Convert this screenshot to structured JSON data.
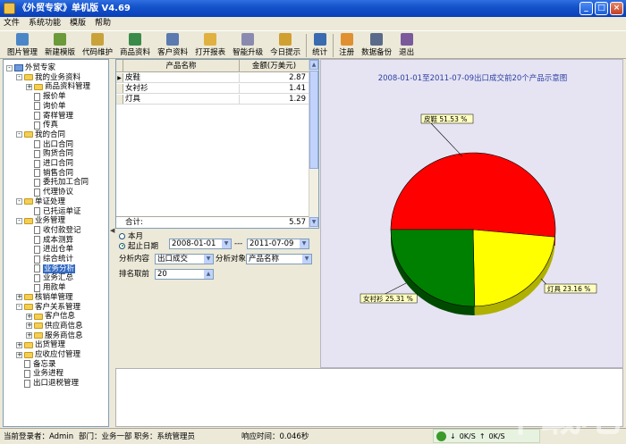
{
  "window": {
    "title": "《外贸专家》单机版 V4.69",
    "min": "_",
    "max": "□",
    "close": "×"
  },
  "menu": [
    "文件",
    "系统功能",
    "模版",
    "帮助"
  ],
  "toolbar": [
    {
      "label": "图片管理",
      "color": "#4a86c7"
    },
    {
      "label": "新建模版",
      "color": "#6a9a3a"
    },
    {
      "label": "代码维护",
      "color": "#c9a23a"
    },
    {
      "label": "商品资料",
      "color": "#3a8a4a"
    },
    {
      "label": "客户资料",
      "color": "#5a7ab0"
    },
    {
      "label": "打开报表",
      "color": "#e0b040"
    },
    {
      "label": "智能升级",
      "color": "#8a8ab0"
    },
    {
      "label": "今日提示",
      "color": "#d0a030"
    },
    {
      "label": "统计",
      "color": "#3a6ab0"
    },
    {
      "label": "注册",
      "color": "#e09030"
    },
    {
      "label": "数据备份",
      "color": "#5a6a8a"
    },
    {
      "label": "退出",
      "color": "#7a5a9a"
    }
  ],
  "tree": {
    "items": [
      {
        "label": "外贸专家",
        "level": 0,
        "type": "root",
        "box": "-"
      },
      {
        "label": "我的业务资料",
        "level": 1,
        "type": "folder",
        "box": "-"
      },
      {
        "label": "商品资料管理",
        "level": 2,
        "type": "folder",
        "box": "+"
      },
      {
        "label": "报价单",
        "level": 2,
        "type": "doc"
      },
      {
        "label": "询价单",
        "level": 2,
        "type": "doc"
      },
      {
        "label": "寄样管理",
        "level": 2,
        "type": "doc"
      },
      {
        "label": "传真",
        "level": 2,
        "type": "doc"
      },
      {
        "label": "我的合同",
        "level": 1,
        "type": "folder",
        "box": "-"
      },
      {
        "label": "出口合同",
        "level": 2,
        "type": "doc"
      },
      {
        "label": "购货合同",
        "level": 2,
        "type": "doc"
      },
      {
        "label": "进口合同",
        "level": 2,
        "type": "doc"
      },
      {
        "label": "销售合同",
        "level": 2,
        "type": "doc"
      },
      {
        "label": "委托加工合同",
        "level": 2,
        "type": "doc"
      },
      {
        "label": "代理协议",
        "level": 2,
        "type": "doc"
      },
      {
        "label": "单证处理",
        "level": 1,
        "type": "folder",
        "box": "-"
      },
      {
        "label": "已托运单证",
        "level": 2,
        "type": "doc"
      },
      {
        "label": "业务管理",
        "level": 1,
        "type": "folder",
        "box": "-"
      },
      {
        "label": "收付款登记",
        "level": 2,
        "type": "doc"
      },
      {
        "label": "成本测算",
        "level": 2,
        "type": "doc"
      },
      {
        "label": "进出仓单",
        "level": 2,
        "type": "doc"
      },
      {
        "label": "综合统计",
        "level": 2,
        "type": "doc"
      },
      {
        "label": "业务分析",
        "level": 2,
        "type": "doc",
        "selected": true
      },
      {
        "label": "业务汇总",
        "level": 2,
        "type": "doc"
      },
      {
        "label": "用款单",
        "level": 2,
        "type": "doc"
      },
      {
        "label": "核销单管理",
        "level": 1,
        "type": "folder",
        "box": "+"
      },
      {
        "label": "客户关系管理",
        "level": 1,
        "type": "folder",
        "box": "-"
      },
      {
        "label": "客户信息",
        "level": 2,
        "type": "folder",
        "box": "+"
      },
      {
        "label": "供应商信息",
        "level": 2,
        "type": "folder",
        "box": "+"
      },
      {
        "label": "服务商信息",
        "level": 2,
        "type": "folder",
        "box": "+"
      },
      {
        "label": "出货管理",
        "level": 1,
        "type": "folder",
        "box": "+"
      },
      {
        "label": "应收应付管理",
        "level": 1,
        "type": "folder",
        "box": "+"
      },
      {
        "label": "备忘录",
        "level": 1,
        "type": "doc"
      },
      {
        "label": "业务进程",
        "level": 1,
        "type": "doc"
      },
      {
        "label": "出口退税管理",
        "level": 1,
        "type": "doc"
      }
    ]
  },
  "grid": {
    "headers": [
      "产品名称",
      "金额(万美元)"
    ],
    "rows": [
      {
        "name": "皮鞋",
        "amount": "2.87",
        "current": "▶"
      },
      {
        "name": "女衬衫",
        "amount": "1.41"
      },
      {
        "name": "灯具",
        "amount": "1.29"
      }
    ],
    "total_label": "合计:",
    "total_value": "5.57"
  },
  "filters": {
    "month_label": "本月",
    "start_label": "起止日期",
    "start_date": "2008-01-01",
    "range_sep": "---",
    "end_date": "2011-07-09",
    "content_label": "分析内容",
    "content_value": "出口成交",
    "object_label": "分析对象",
    "object_value": "产品名称",
    "rank_label": "排名取前",
    "rank_value": "20"
  },
  "chart_data": {
    "type": "pie",
    "title": "2008-01-01至2011-07-09出口成交前20个产品示意图",
    "slices": [
      {
        "label": "皮鞋",
        "percent": 51.53,
        "display": "皮鞋 51.53 %",
        "color": "#ff0000"
      },
      {
        "label": "灯具",
        "percent": 23.16,
        "display": "灯具 23.16 %",
        "color": "#ffff00"
      },
      {
        "label": "女衬衫",
        "percent": 25.31,
        "display": "女衬衫 25.31 %",
        "color": "#008000"
      }
    ]
  },
  "status": {
    "user": "当前登录者：Admin",
    "dept": "部门：业务一部",
    "role": "职务：系统管理员",
    "response": "响应时间：0.046秒"
  },
  "tray": {
    "down": "0K/S",
    "up": "0K/S"
  },
  "watermark": "下载吧"
}
